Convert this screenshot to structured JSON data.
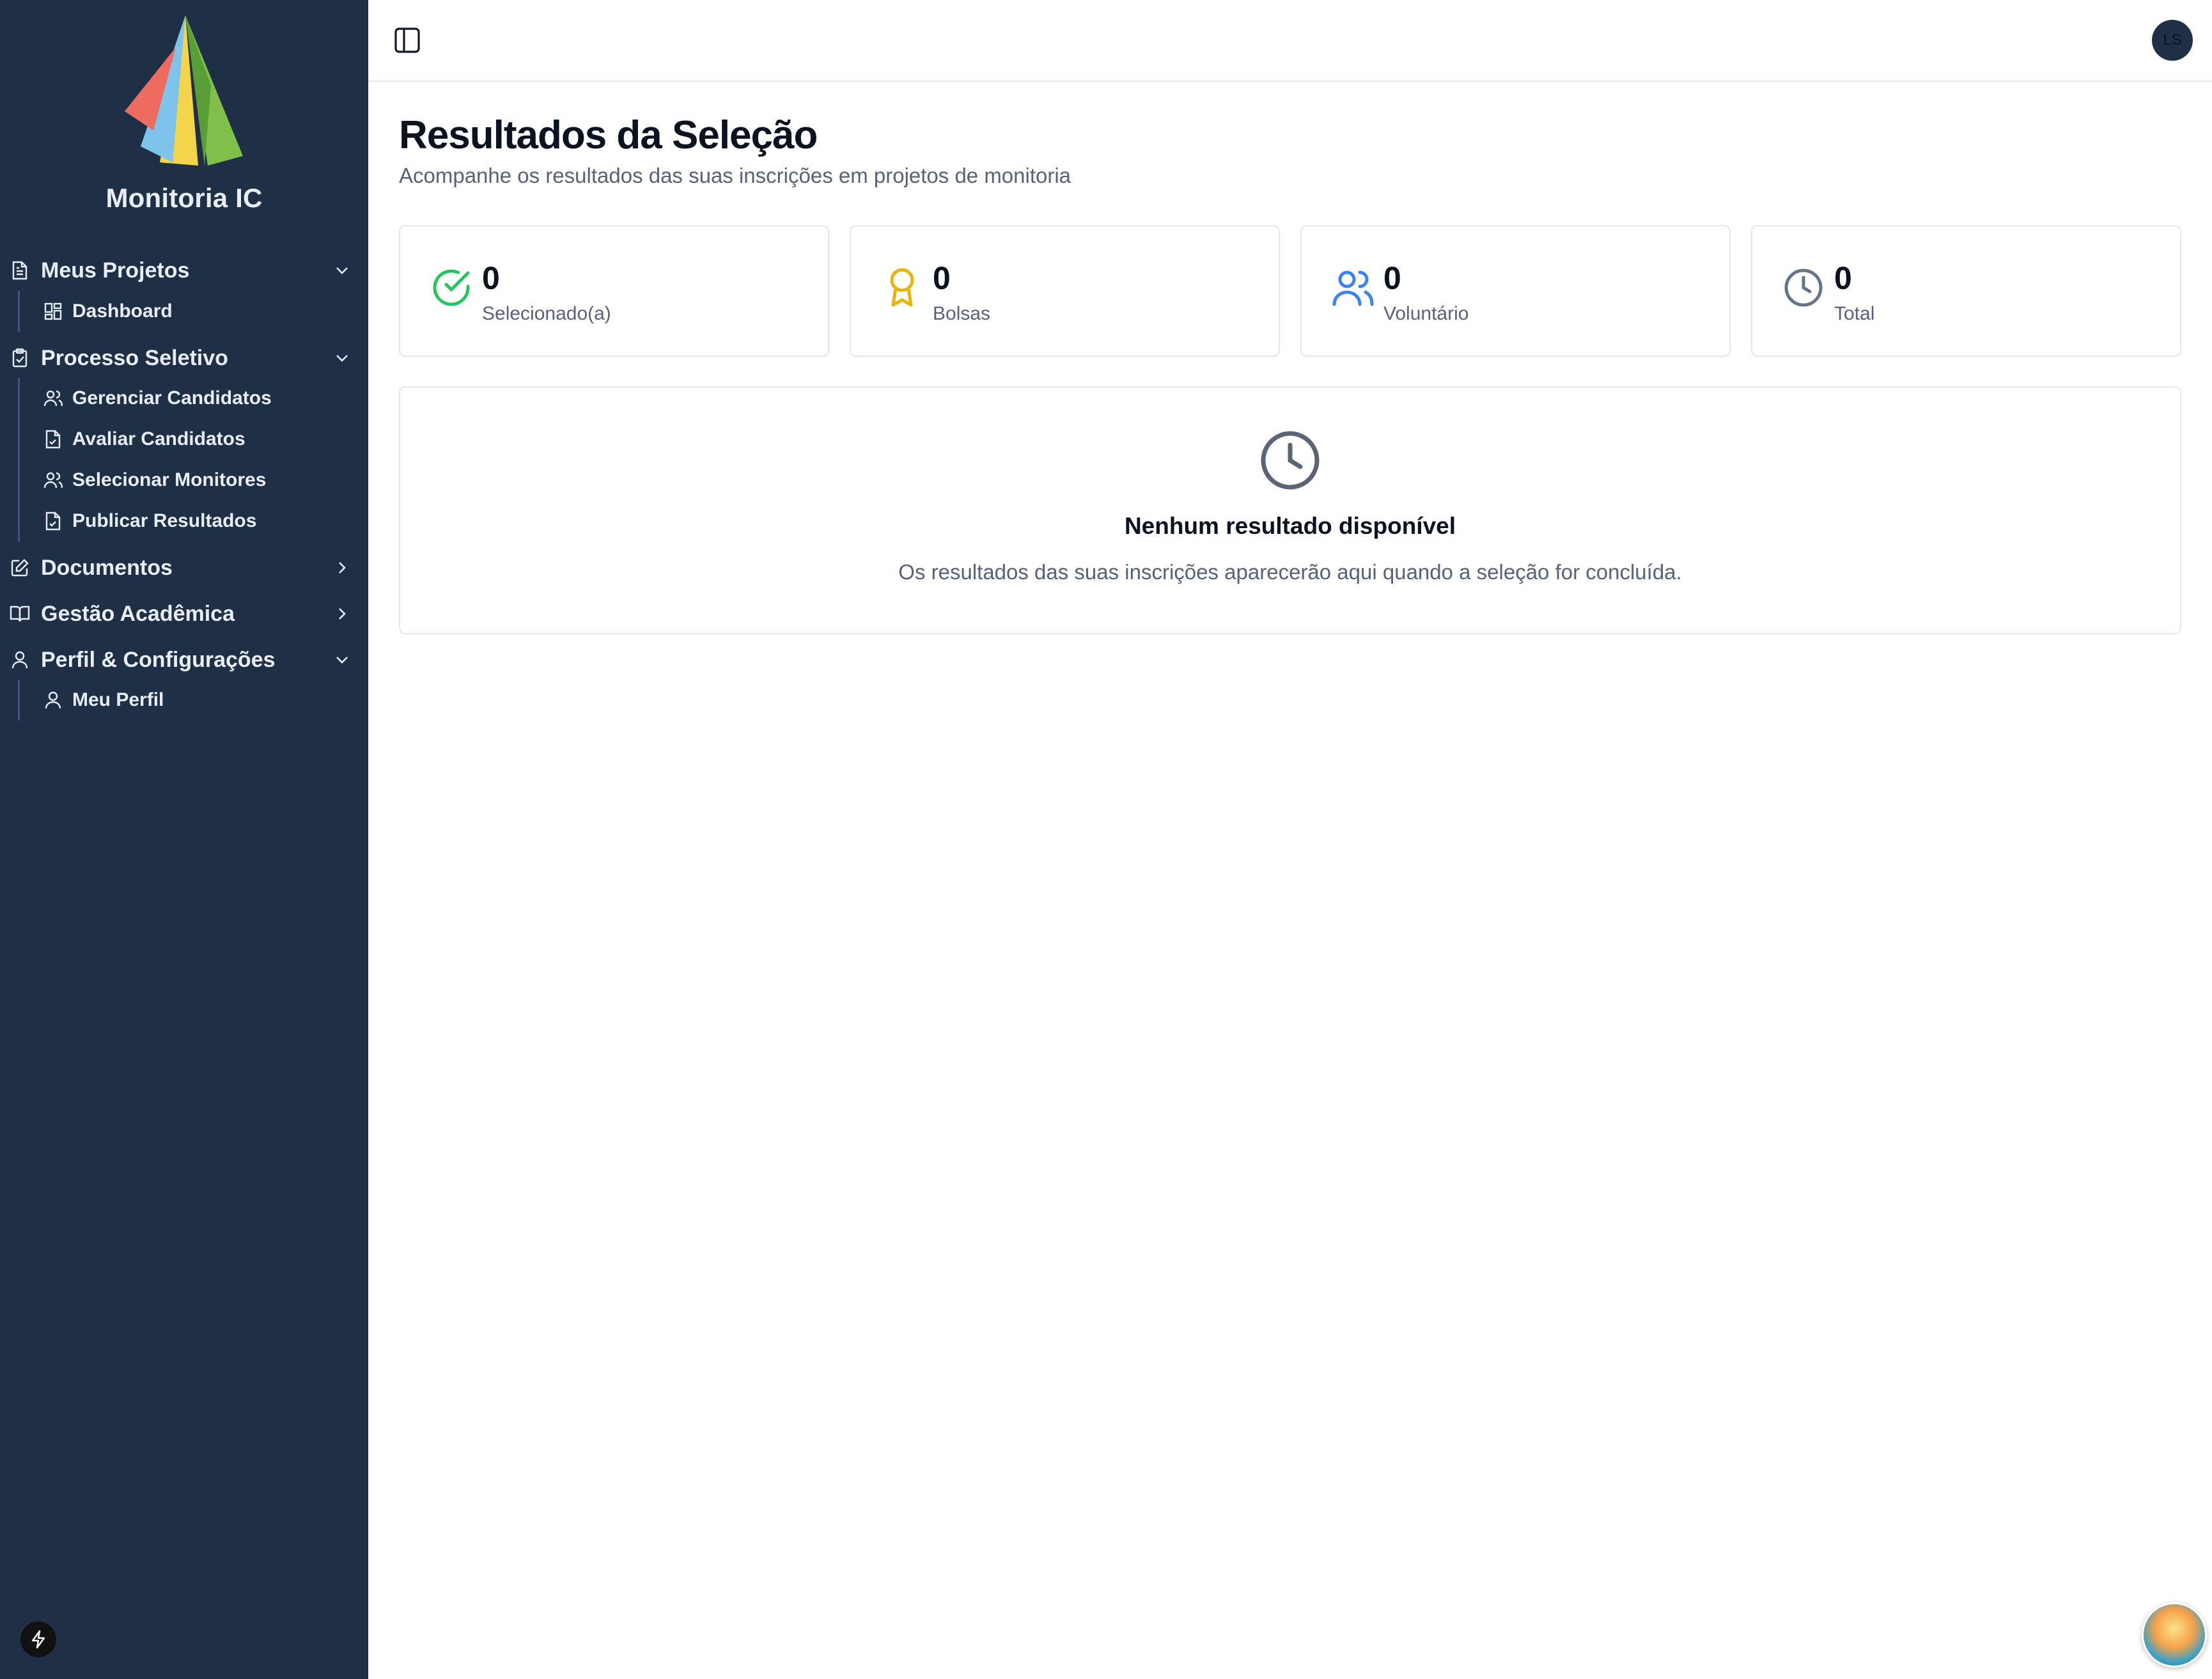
{
  "app": {
    "brand": "Monitoria IC"
  },
  "sidebar": {
    "groups": [
      {
        "label": "Meus Projetos",
        "icon": "document-icon",
        "expanded": true,
        "items": [
          {
            "label": "Dashboard",
            "icon": "dashboard-icon"
          }
        ]
      },
      {
        "label": "Processo Seletivo",
        "icon": "clipboard-check-icon",
        "expanded": true,
        "items": [
          {
            "label": "Gerenciar Candidatos",
            "icon": "users-icon"
          },
          {
            "label": "Avaliar Candidatos",
            "icon": "file-check-icon"
          },
          {
            "label": "Selecionar Monitores",
            "icon": "users-icon"
          },
          {
            "label": "Publicar Resultados",
            "icon": "file-check-icon"
          }
        ]
      },
      {
        "label": "Documentos",
        "icon": "edit-document-icon",
        "expanded": false,
        "items": []
      },
      {
        "label": "Gestão Acadêmica",
        "icon": "book-icon",
        "expanded": false,
        "items": []
      },
      {
        "label": "Perfil & Configurações",
        "icon": "user-icon",
        "expanded": true,
        "items": [
          {
            "label": "Meu Perfil",
            "icon": "user-icon"
          }
        ]
      }
    ]
  },
  "header": {
    "avatar_initials": "LS"
  },
  "main": {
    "title": "Resultados da Seleção",
    "subtitle": "Acompanhe os resultados das suas inscrições em projetos de monitoria",
    "stats": [
      {
        "value": "0",
        "label": "Selecionado(a)",
        "icon": "check-circle-icon",
        "color": "#22c55e"
      },
      {
        "value": "0",
        "label": "Bolsas",
        "icon": "award-icon",
        "color": "#eab308"
      },
      {
        "value": "0",
        "label": "Voluntário",
        "icon": "users-icon",
        "color": "#3b82f6"
      },
      {
        "value": "0",
        "label": "Total",
        "icon": "clock-icon",
        "color": "#64748b"
      }
    ],
    "empty_state": {
      "icon": "clock-icon",
      "title": "Nenhum resultado disponível",
      "text": "Os resultados das suas inscrições aparecerão aqui quando a seleção for concluída."
    }
  },
  "colors": {
    "sidebar_bg": "#1f2f46",
    "accent_line": "#4a4f86"
  }
}
